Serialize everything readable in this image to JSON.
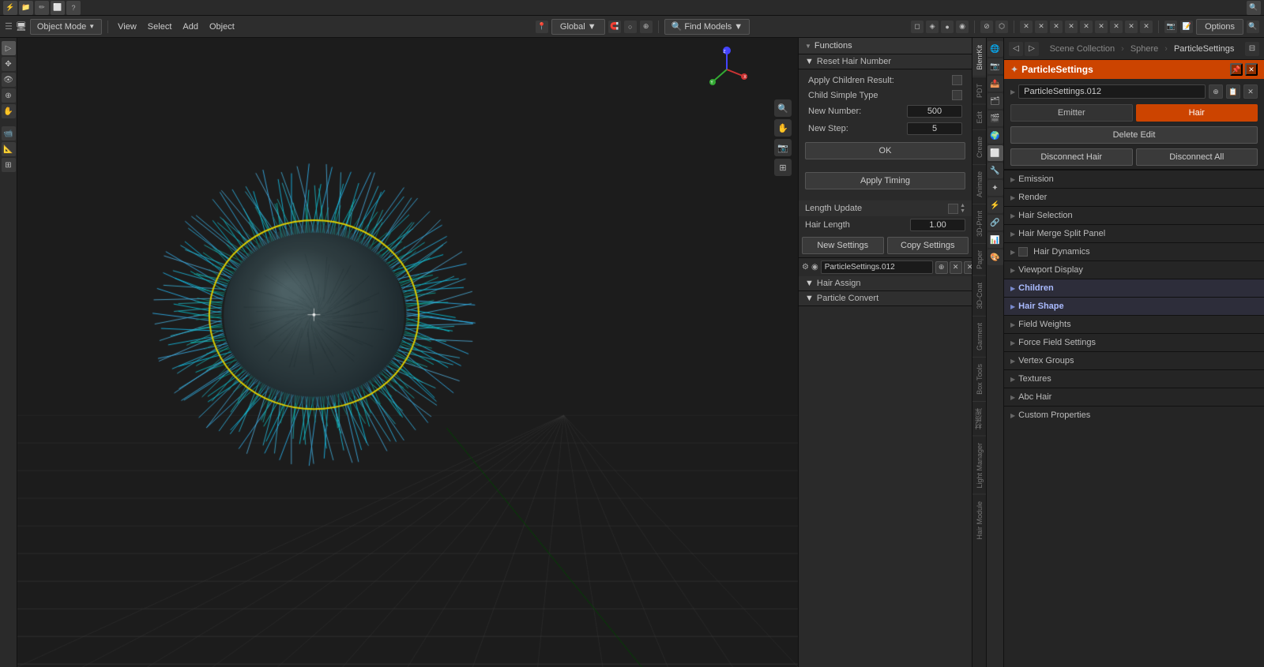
{
  "topbar": {
    "mode_label": "Object Mode",
    "nav_items": [
      "View",
      "Select",
      "Add",
      "Object"
    ],
    "global_label": "Global",
    "find_models_label": "Find Models",
    "options_label": "Options"
  },
  "functions_panel": {
    "title": "Functions",
    "reset_hair_title": "Reset Hair Number",
    "apply_children_label": "Apply Children Result:",
    "child_simple_label": "Child Simple Type",
    "new_number_label": "New Number:",
    "new_number_value": "500",
    "new_step_label": "New Step:",
    "new_step_value": "5",
    "ok_label": "OK",
    "apply_timing_label": "Apply Timing",
    "length_update_label": "Length Update",
    "hair_length_label": "Hair Length",
    "hair_length_value": "1.00",
    "new_settings_label": "New Settings",
    "copy_settings_label": "Copy Settings",
    "particle_name": "ParticleSettings.012",
    "hair_assign_label": "Hair Assign",
    "particle_convert_label": "Particle Convert"
  },
  "side_tabs": [
    "BlenrKit",
    "PDT",
    "Edit",
    "Create",
    "Animate",
    "3D-Print",
    "Paper",
    "3D-Coat",
    "Garment",
    "Box Tools",
    "材质库",
    "Light Manager",
    "Hair Module"
  ],
  "properties_panel": {
    "title": "ParticleSettings",
    "collection_label": "Scene Collection",
    "sphere_label": "Sphere",
    "particle_settings_label": "ParticleSettings",
    "particle_name": "ParticleSettings.012",
    "emitter_label": "Emitter",
    "hair_label": "Hair",
    "delete_edit_label": "Delete Edit",
    "disconnect_hair_label": "Disconnect Hair",
    "disconnect_all_label": "Disconnect All",
    "sections": [
      {
        "title": "Emission",
        "has_expand": true
      },
      {
        "title": "Render",
        "has_expand": true
      },
      {
        "title": "Hair Selection",
        "has_expand": true
      },
      {
        "title": "Hair Merge Split Panel",
        "has_expand": true
      },
      {
        "title": "Hair Dynamics",
        "has_expand": true,
        "has_checkbox": true
      },
      {
        "title": "Viewport Display",
        "has_expand": true
      },
      {
        "title": "Children",
        "has_expand": true,
        "highlighted": true
      },
      {
        "title": "Hair Shape",
        "has_expand": true,
        "highlighted": true
      },
      {
        "title": "Field Weights",
        "has_expand": true
      },
      {
        "title": "Force Field Settings",
        "has_expand": true
      },
      {
        "title": "Vertex Groups",
        "has_expand": true
      },
      {
        "title": "Textures",
        "has_expand": true
      },
      {
        "title": "Abc Hair",
        "has_expand": true
      },
      {
        "title": "Custom Properties",
        "has_expand": true
      }
    ]
  },
  "viewport": {
    "sphere_color_primary": "#00ccaa",
    "sphere_color_secondary": "#004466",
    "ring_color": "#ddcc00"
  },
  "gizmo": {
    "x_color": "#cc0000",
    "y_color": "#00cc00",
    "z_color": "#4444ff"
  }
}
